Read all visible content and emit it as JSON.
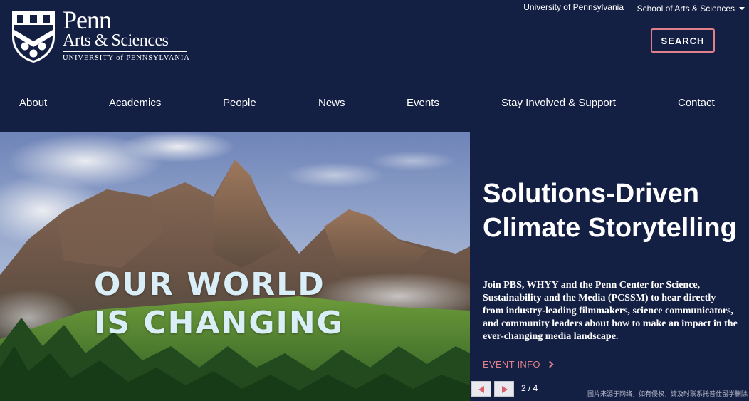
{
  "header": {
    "logo": {
      "penn": "Penn",
      "arts_sciences": "Arts & Sciences",
      "university": "UNIVERSITY of PENNSYLVANIA"
    },
    "top_links": {
      "upenn": "University of Pennsylvania",
      "sas": "School of Arts & Sciences"
    },
    "search_label": "SEARCH"
  },
  "nav": {
    "items": [
      {
        "label": "About"
      },
      {
        "label": "Academics"
      },
      {
        "label": "People"
      },
      {
        "label": "News"
      },
      {
        "label": "Events"
      },
      {
        "label": "Stay Involved & Support"
      },
      {
        "label": "Contact"
      }
    ]
  },
  "hero": {
    "overlay_line1": "OUR WORLD",
    "overlay_line2": "IS CHANGING",
    "title": "Solutions-Driven Climate Storytelling",
    "description": "Join PBS, WHYY and the Penn Center for Science, Sustainability and the Media (PCSSM) to hear directly from industry-leading filmmakers, science communicators, and community leaders about how to make an impact in the ever-changing media landscape.",
    "link_label": "EVENT INFO",
    "slide_counter": "2 / 4",
    "watermark": "图片来源于网络，如有侵权，请及时联系托普仕留学删除"
  },
  "colors": {
    "navy": "#141f44",
    "accent": "#e0808a"
  },
  "icons": {
    "search_caret": "chevron-down-icon",
    "event_link": "chevron-right-icon",
    "prev": "triangle-left-icon",
    "next": "triangle-right-icon"
  }
}
